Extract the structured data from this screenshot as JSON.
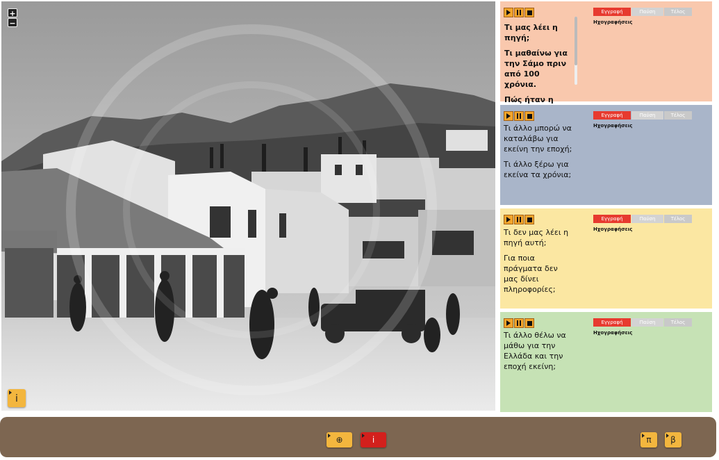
{
  "map": {
    "zoom_in_label": "+",
    "zoom_out_label": "−",
    "info_label": "i"
  },
  "cards": [
    {
      "color": "#f9c8ad",
      "lines": [
        "Τι μας λέει η πηγή;",
        "Τι μαθαίνω για την Σάμο πριν από 100 χρόνια.",
        "Πώς ήταν η ζωή,"
      ],
      "rec_label": "Εγγραφή",
      "pause_label": "Παύση",
      "end_label": "Τέλος",
      "recordings_label": "Ηχογραφήσεις"
    },
    {
      "color": "#a9b5c9",
      "lines": [
        "Τι άλλο μπορώ να καταλάβω για εκείνη την εποχή;",
        "Τι άλλο ξέρω για εκείνα τα χρόνια;"
      ],
      "rec_label": "Εγγραφή",
      "pause_label": "Παύση",
      "end_label": "Τέλος",
      "recordings_label": "Ηχογραφήσεις"
    },
    {
      "color": "#fbe7a2",
      "lines": [
        "Τι δεν μας λέει η πηγή αυτή;",
        "Για ποια πράγματα δεν μας δίνει πληροφορίες;"
      ],
      "rec_label": "Εγγραφή",
      "pause_label": "Παύση",
      "end_label": "Τέλος",
      "recordings_label": "Ηχογραφήσεις"
    },
    {
      "color": "#c6e2b5",
      "lines": [
        "Τι άλλο θέλω να μάθω για την Ελλάδα και την εποχή εκείνη;"
      ],
      "rec_label": "Εγγραφή",
      "pause_label": "Παύση",
      "end_label": "Τέλος",
      "recordings_label": "Ηχογραφήσεις"
    }
  ],
  "bottombar": {
    "color": "#7d6651",
    "add_label": "⊕",
    "info_label": "i",
    "prev_label": "π",
    "next_label": "β"
  }
}
